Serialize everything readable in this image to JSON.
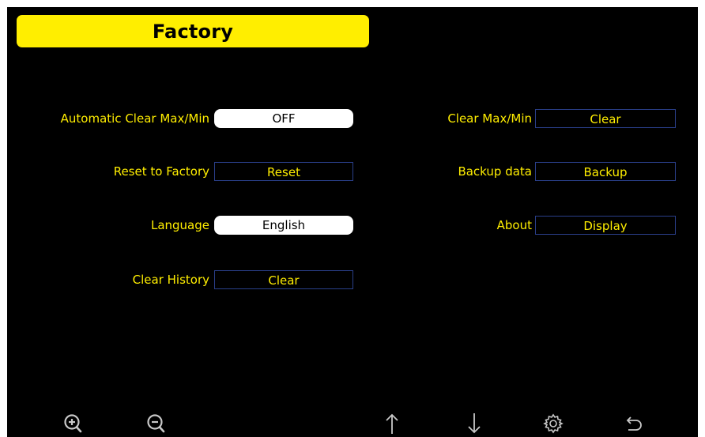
{
  "header": {
    "title": "Factory"
  },
  "left_settings": [
    {
      "label": "Automatic Clear Max/Min",
      "value": "OFF"
    },
    {
      "label": "Reset to Factory",
      "value": "Reset"
    },
    {
      "label": "Language",
      "value": "English"
    },
    {
      "label": "Clear History",
      "value": "Clear"
    }
  ],
  "right_settings": [
    {
      "label": "Clear Max/Min",
      "value": "Clear"
    },
    {
      "label": "Backup data",
      "value": "Backup"
    },
    {
      "label": "About",
      "value": "Display"
    }
  ],
  "toolbar": {
    "icons": [
      "zoom-in-icon",
      "zoom-out-icon",
      "arrow-up-icon",
      "arrow-down-icon",
      "gear-icon",
      "back-icon"
    ]
  },
  "colors": {
    "background": "#000000",
    "accent": "#ffee00",
    "control_border": "#2a3f8a",
    "toggle_fill": "#ffffff",
    "icon": "#c8c8c8"
  }
}
